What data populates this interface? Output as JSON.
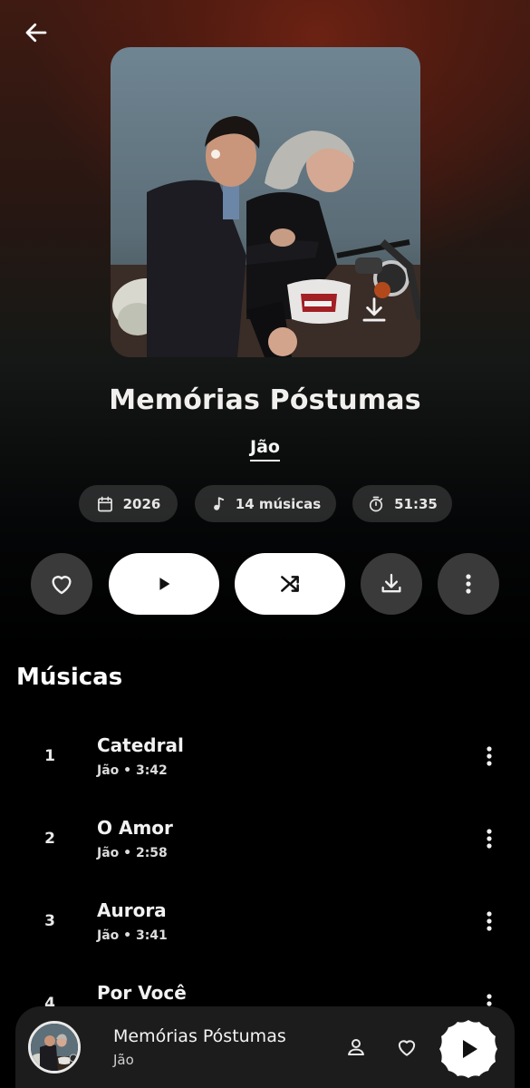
{
  "album": {
    "title": "Memórias Póstumas",
    "artist": "Jão",
    "year": "2026",
    "track_count": "14 músicas",
    "duration": "51:35"
  },
  "section": {
    "title": "Músicas"
  },
  "tracks": [
    {
      "number": "1",
      "title": "Catedral",
      "meta": "Jão • 3:42"
    },
    {
      "number": "2",
      "title": "O Amor",
      "meta": "Jão • 2:58"
    },
    {
      "number": "3",
      "title": "Aurora",
      "meta": "Jão • 3:41"
    },
    {
      "number": "4",
      "title": "Por Você",
      "meta": ""
    }
  ],
  "now_playing": {
    "title": "Memórias Póstumas",
    "artist": "Jão"
  },
  "icons": {
    "back": "arrow-left-icon",
    "cover_download": "download-icon",
    "year": "calendar-icon",
    "tracks": "music-note-icon",
    "duration": "stopwatch-icon",
    "like": "heart-icon",
    "play": "play-icon",
    "shuffle": "shuffle-icon",
    "download": "download-icon",
    "more": "more-vertical-icon",
    "artist": "person-icon"
  },
  "colors": {
    "background": "#000000",
    "gradient_top": "#6b2213",
    "chip_bg": "#3a3a3a",
    "primary_button": "#ffffff",
    "mini_player_bg": "#1c1c1c"
  }
}
